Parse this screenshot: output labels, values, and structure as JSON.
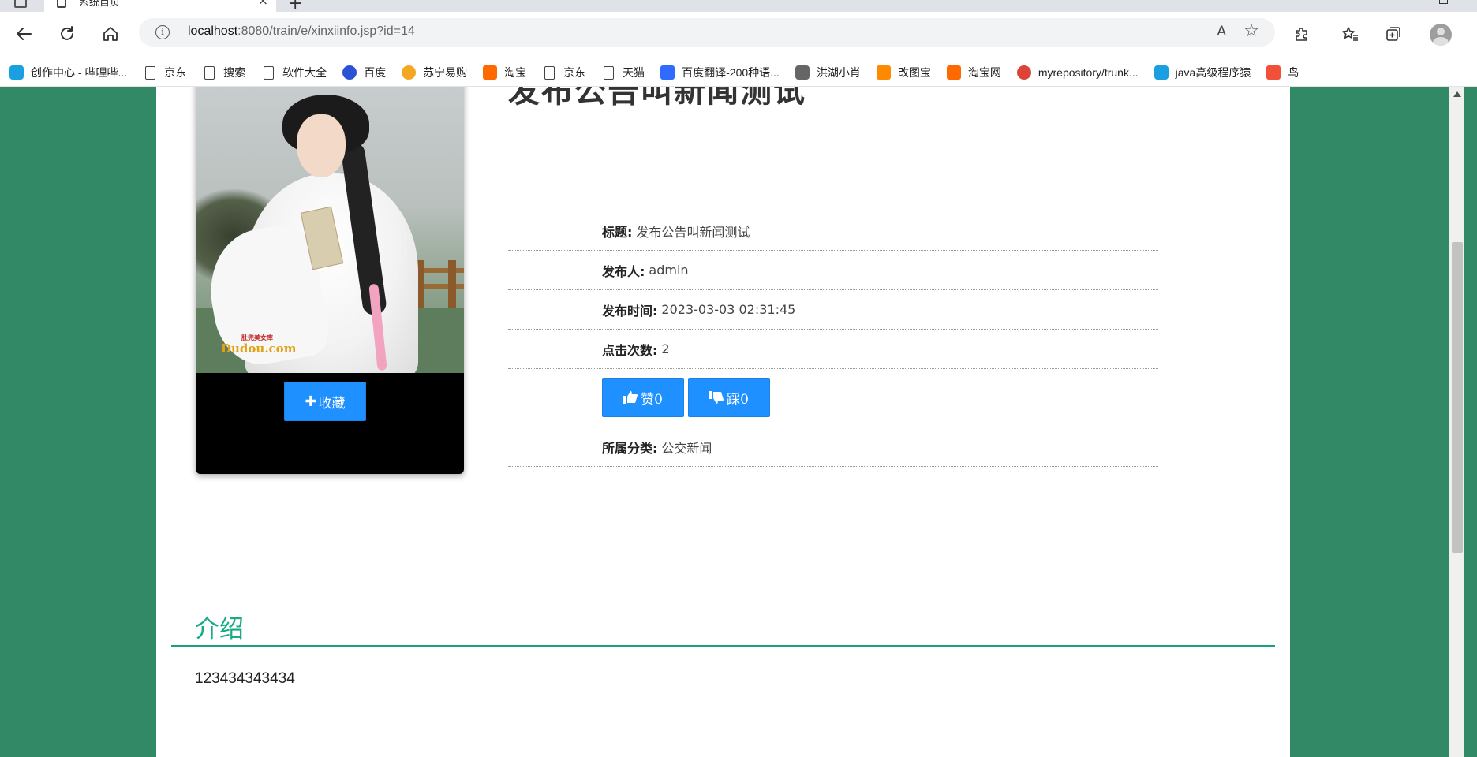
{
  "browser": {
    "tab_title": "系统首页",
    "url_host": "localhost",
    "url_rest": ":8080/train/e/xinxiinfo.jsp?id=14",
    "info_icon_glyph": "i",
    "read_aloud_glyph": "A",
    "favorite_glyph": "☆",
    "new_tab_glyph": "+",
    "close_tab_glyph": "×"
  },
  "bookmarks": [
    {
      "label": "创作中心 - 哔哩哔...",
      "icon": "bilibili-icon",
      "color": "#1aa0e0"
    },
    {
      "label": "京东",
      "icon": "page-icon",
      "color": ""
    },
    {
      "label": "搜索",
      "icon": "page-icon",
      "color": ""
    },
    {
      "label": "软件大全",
      "icon": "page-icon",
      "color": ""
    },
    {
      "label": "百度",
      "icon": "baidu-icon",
      "color": "#2b52d4"
    },
    {
      "label": "苏宁易购",
      "icon": "suning-icon",
      "color": "#f5a623"
    },
    {
      "label": "淘宝",
      "icon": "taobao-icon",
      "color": "#ff6a00"
    },
    {
      "label": "京东",
      "icon": "page-icon",
      "color": ""
    },
    {
      "label": "天猫",
      "icon": "page-icon",
      "color": ""
    },
    {
      "label": "百度翻译-200种语...",
      "icon": "baidu-translate-icon",
      "color": "#2f6bff"
    },
    {
      "label": "洪湖小肖",
      "icon": "bird-icon",
      "color": "#666666"
    },
    {
      "label": "改图宝",
      "icon": "gaitubao-icon",
      "color": "#ff8a00"
    },
    {
      "label": "淘宝网",
      "icon": "taobao-icon",
      "color": "#ff6a00"
    },
    {
      "label": "myrepository/trunk...",
      "icon": "chrome-icon",
      "color": "#db4437"
    },
    {
      "label": "java高级程序猿",
      "icon": "bilibili-icon",
      "color": "#1aa0e0"
    },
    {
      "label": "鸟",
      "icon": "swift-icon",
      "color": "#f05138"
    }
  ],
  "article": {
    "heading": "发布公告叫新闻测试",
    "fields": {
      "title_label": "标题:",
      "title_value": "发布公告叫新闻测试",
      "publisher_label": "发布人:",
      "publisher_value": "admin",
      "time_label": "发布时间:",
      "time_value": "2023-03-03 02:31:45",
      "clicks_label": "点击次数:",
      "clicks_value": "2",
      "category_label": "所属分类:",
      "category_value": "公交新闻"
    },
    "like_label": "赞0",
    "dislike_label": "踩0",
    "favorite_label": "收藏",
    "favorite_plus": "✚"
  },
  "photo": {
    "watermark": "Dudou.com",
    "watermark_small": "肚兜美女库"
  },
  "intro": {
    "title": "介绍",
    "body": "123434343434"
  },
  "colors": {
    "page_background": "#318965",
    "button_blue": "#1e90ff",
    "section_accent": "#1aa185"
  }
}
